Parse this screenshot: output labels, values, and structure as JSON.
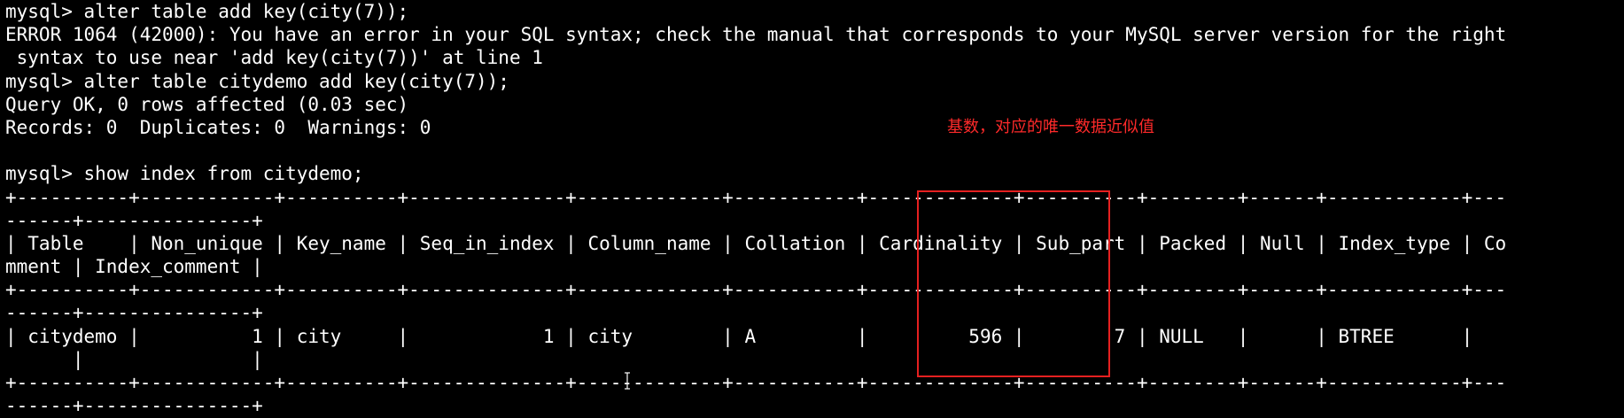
{
  "terminal": {
    "lines": [
      "mysql> alter table add key(city(7));",
      "ERROR 1064 (42000): You have an error in your SQL syntax; check the manual that corresponds to your MySQL server version for the right",
      " syntax to use near 'add key(city(7))' at line 1",
      "mysql> alter table citydemo add key(city(7));",
      "Query OK, 0 rows affected (0.03 sec)",
      "Records: 0  Duplicates: 0  Warnings: 0",
      "",
      "mysql> show index from citydemo;",
      "+----------+------------+----------+--------------+-------------+-----------+-------------+----------+--------+------+------------+---",
      "------+---------------+",
      "| Table    | Non_unique | Key_name | Seq_in_index | Column_name | Collation | Cardinality | Sub_part | Packed | Null | Index_type | Co",
      "mment | Index_comment |",
      "+----------+------------+----------+--------------+-------------+-----------+-------------+----------+--------+------+------------+---",
      "------+---------------+",
      "| citydemo |          1 | city     |            1 | city        | A         |         596 |        7 | NULL   |      | BTREE      |",
      "      |               |",
      "+----------+------------+----------+--------------+-------------+-----------+-------------+----------+--------+------+------------+---",
      "------+---------------+"
    ]
  },
  "annotation": {
    "text": "基数，对应的唯一数据近似值"
  },
  "colors": {
    "background": "#000000",
    "text": "#ffffff",
    "annotation": "#ff2a2a",
    "highlight_border": "#e52020"
  }
}
